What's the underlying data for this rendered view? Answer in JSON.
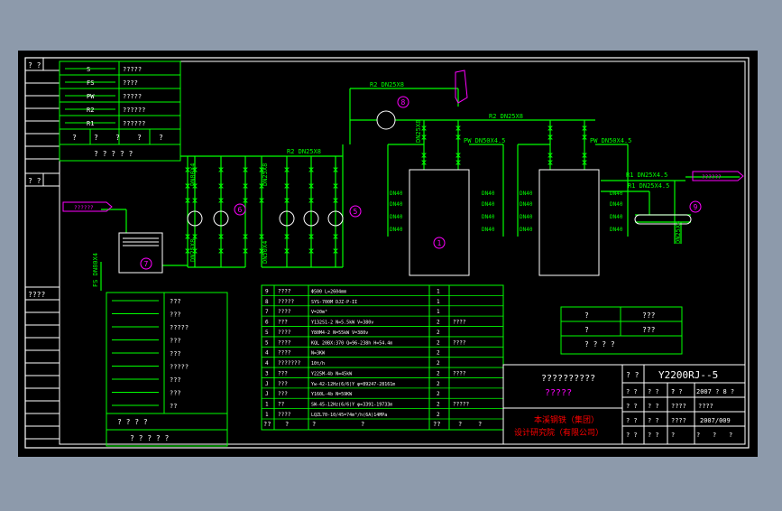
{
  "colors": {
    "background": "#8d9aab",
    "sheet": "#000000",
    "frame": "#ffffff",
    "line": "#00ff00",
    "accent": "#ff00ff",
    "text": "#ffffff",
    "cyan": "#00ffff",
    "red": "#ff0000"
  },
  "left_margin": {
    "top_label": "?  ?",
    "mid_label": "?  ?",
    "low_label": "????"
  },
  "legend": {
    "rows": [
      {
        "code": "S",
        "desc": "?????"
      },
      {
        "code": "FS",
        "desc": "????"
      },
      {
        "code": "PW",
        "desc": "?????"
      },
      {
        "code": "R2",
        "desc": "??????"
      },
      {
        "code": "R1",
        "desc": "??????"
      }
    ],
    "header_cells": [
      "?",
      "?",
      "?",
      "?",
      "?"
    ],
    "footer": "? ? ? ? ?"
  },
  "diagram_labels": {
    "r2_top": "R2  DN25X8",
    "r2_mid": "R2  DN25X8",
    "r2_right": "R2  DN25X8",
    "pw_left": "PW  DN50X4.5",
    "pw_right": "PW  DN50X4.5",
    "r1_a": "R1  DN25X4.5",
    "r1_b": "R1  DN25X4.5",
    "fs_left": "FS  DN80X4",
    "left_dn": "DN80X4",
    "riser_a": "DN25X8",
    "riser_b": "DN25X8",
    "riser_c": "DN50X4",
    "riser_d": "DN25X8",
    "riser_e": "DN25X4",
    "dn40": "DN40",
    "callouts": [
      "8",
      "6",
      "5",
      "1",
      "7",
      "9"
    ],
    "inlet_arrow": "??????",
    "outlet_arrow": "??????"
  },
  "symbols_table": {
    "rows": [
      "???",
      "???",
      "?????",
      "???",
      "???",
      "?????",
      "???",
      "???",
      "??"
    ],
    "footer_a": "? ? ? ?",
    "footer_b": "? ? ? ? ?"
  },
  "equipment_table": {
    "rows": [
      [
        "9",
        "????",
        "Φ500  L=2604mm",
        "1",
        ""
      ],
      [
        "8",
        "?????",
        "SYS-700M DJZ-P-II",
        "1",
        ""
      ],
      [
        "7",
        "????",
        "V=20m³",
        "1",
        ""
      ],
      [
        "6",
        "???",
        "Y132S1-2  N=5.5kW V=380v",
        "2",
        "????"
      ],
      [
        "5",
        "????",
        "Y80M4-2  N=55kW  V=380v",
        "2",
        ""
      ],
      [
        "5",
        "????",
        "KQL 20BX:370 Q=96-238h H=54.4m",
        "2",
        "????"
      ],
      [
        "4",
        "????",
        "N=3KW",
        "2",
        ""
      ],
      [
        "4",
        "???????",
        "10t/h",
        "2",
        ""
      ],
      [
        "3",
        "???",
        "Y225M-4b  N=45kW",
        "2",
        "????"
      ],
      [
        "J",
        "???",
        "Yw-42-12Hz(6/6)Y  φ=89247-28161m",
        "2",
        ""
      ],
      [
        "J",
        "???",
        "Y160L-4b  N=59KW",
        "2",
        ""
      ],
      [
        "1",
        "??",
        "SW-45-12Hz(6/6)Y  φ=3391-19733m",
        "2",
        "?????"
      ],
      [
        "1",
        "????",
        "LQZL70-10/45=74m³/h(6A)14MPa",
        "2",
        ""
      ]
    ],
    "footer": [
      "??",
      "?",
      "?",
      "?",
      "??",
      "?",
      "?"
    ]
  },
  "small_table": {
    "rows": [
      "?",
      "?",
      "? ? ? ?"
    ],
    "row_right": [
      "???",
      "???",
      ""
    ]
  },
  "title_block": {
    "project": "??????????",
    "subtitle": "?????",
    "drawing_no": "Y2200RJ--5",
    "company_line1": "本溪钢铁（集团）",
    "company_line2": "设计研究院（有限公司）",
    "r1_a": "? ?",
    "r1_b": "Y2200RJ--5",
    "r2": [
      "?  ?",
      "?  ?",
      "?",
      "?  ?",
      "2007  ?  8  ?"
    ],
    "r3": [
      "?  ?",
      "?  ?",
      "????",
      "????"
    ],
    "r4": [
      "?  ?",
      "?  ?",
      "????",
      "2007/009"
    ],
    "r5": [
      "?  ?",
      "?  ?",
      "?",
      "?",
      "?",
      "?"
    ]
  }
}
